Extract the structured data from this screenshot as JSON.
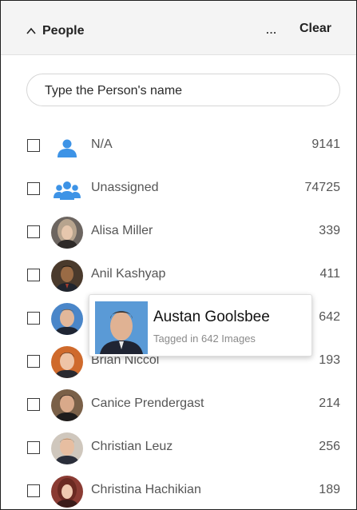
{
  "panel": {
    "title": "People",
    "more_label": "...",
    "clear_label": "Clear"
  },
  "search": {
    "placeholder": "Type the Person's name",
    "value": ""
  },
  "people": [
    {
      "name": "N/A",
      "count": "9141",
      "checked": false,
      "avatar": "person-icon"
    },
    {
      "name": "Unassigned",
      "count": "74725",
      "checked": false,
      "avatar": "group-icon"
    },
    {
      "name": "Alisa Miller",
      "count": "339",
      "checked": false,
      "avatar": "photo"
    },
    {
      "name": "Anil Kashyap",
      "count": "411",
      "checked": false,
      "avatar": "photo"
    },
    {
      "name": "",
      "count": "642",
      "checked": false,
      "avatar": "photo"
    },
    {
      "name": "Brian Niccol",
      "count": "193",
      "checked": false,
      "avatar": "photo"
    },
    {
      "name": "Canice Prendergast",
      "count": "214",
      "checked": false,
      "avatar": "photo"
    },
    {
      "name": "Christian Leuz",
      "count": "256",
      "checked": false,
      "avatar": "photo"
    },
    {
      "name": "Christina Hachikian",
      "count": "189",
      "checked": false,
      "avatar": "photo"
    }
  ],
  "tooltip": {
    "name": "Austan Goolsbee",
    "subtitle": "Tagged in 642 Images"
  },
  "colors": {
    "accent": "#3d93e6",
    "header_bg": "#f4f4f4",
    "text": "#555555"
  }
}
